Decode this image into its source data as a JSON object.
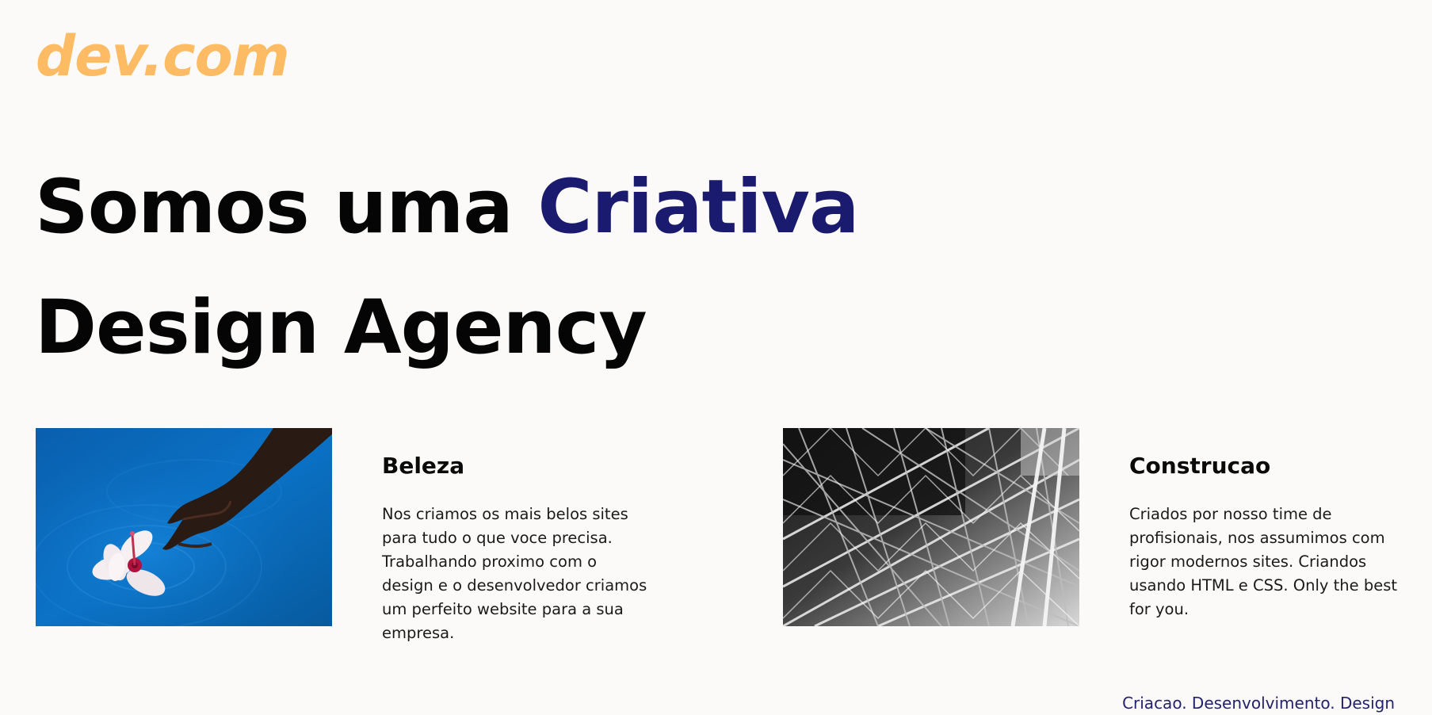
{
  "header": {
    "logo_text": "dev.com"
  },
  "hero": {
    "title_prefix": "Somos uma ",
    "title_accent": "Criativa",
    "title_line2": "Design Agency"
  },
  "cards": [
    {
      "image": "hand-touching-flower-in-water",
      "title": "Beleza",
      "text": "Nos criamos os mais belos sites para tudo o que voce precisa. Trabalhando proximo com o design e o desenvolvedor criamos um perfeito website para a sua empresa."
    },
    {
      "image": "steel-lattice-structure-bw",
      "title": "Construcao",
      "text": "Criados por nosso time de profisionais, nos assumimos com rigor modernos sites. Criandos usando HTML e CSS. Only the best for you."
    }
  ],
  "footer": {
    "tagline": "Criacao. Desenvolvimento. Design"
  },
  "colors": {
    "background": "#fbfaf8",
    "logo": "#fdbb63",
    "accent": "#1a1a6e",
    "water": "#0b6fc0",
    "text": "#111111"
  }
}
